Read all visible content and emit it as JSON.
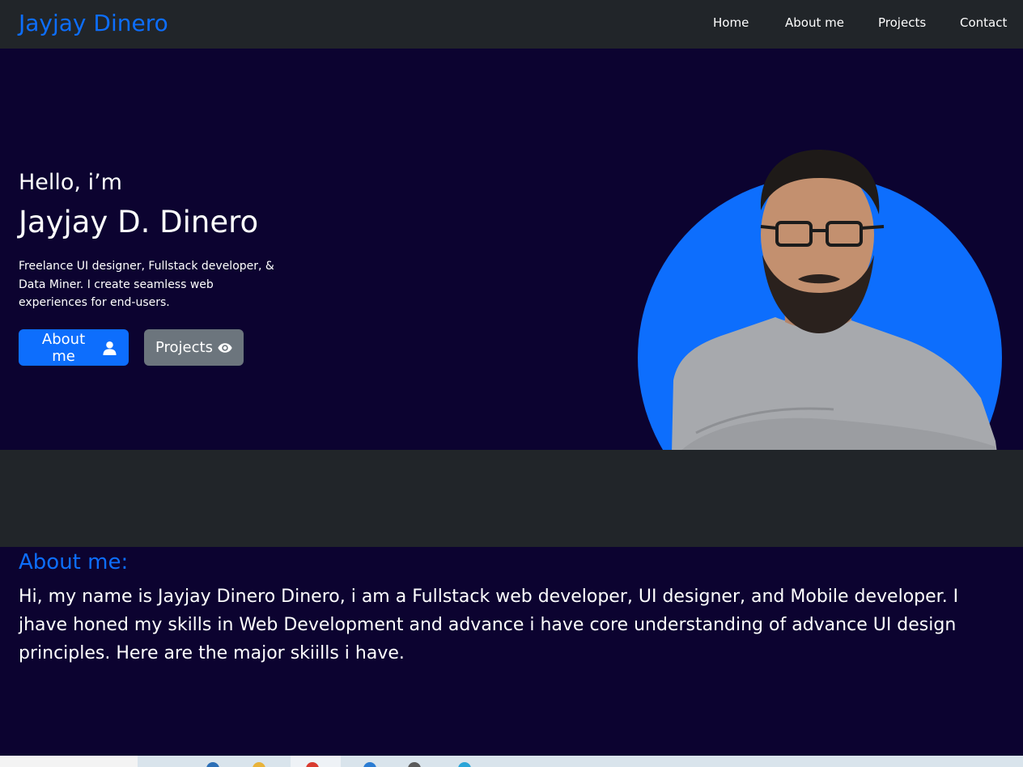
{
  "navbar": {
    "brand": "Jayjay Dinero",
    "links": [
      "Home",
      "About me",
      "Projects",
      "Contact"
    ]
  },
  "hero": {
    "greeting": "Hello, i’m",
    "name": "Jayjay D. Dinero",
    "tagline": "Freelance UI designer, Fullstack developer, & Data Miner. I create seamless web experiences for end-users.",
    "buttons": {
      "about_label": "About me",
      "about_icon": "user-icon",
      "projects_label": "Projects",
      "projects_icon": "eye-icon"
    }
  },
  "about": {
    "title": "About me:",
    "text": "Hi, my name is Jayjay Dinero Dinero, i am a Fullstack web developer, UI designer, and Mobile developer. I jhave honed my skills in Web Development and advance i have core understanding of advance UI design principles. Here are the major skiills i have."
  },
  "colors": {
    "accent": "#0d6efd",
    "navbar_bg": "#212529",
    "page_bg": "#0c0330",
    "secondary_button": "#6c757d"
  }
}
